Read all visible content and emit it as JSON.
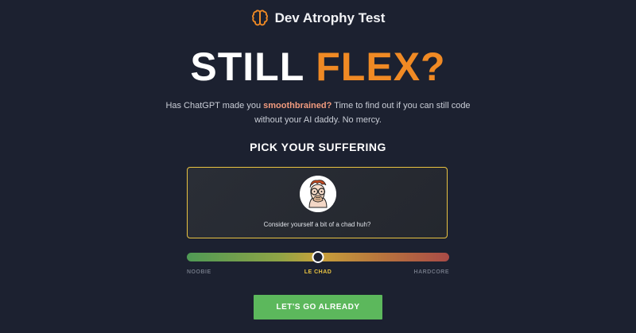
{
  "header": {
    "title": "Dev Atrophy Test",
    "icon": "brain-icon",
    "icon_color": "#f08a24"
  },
  "hero": {
    "word1": "STILL",
    "word2": "FLEX?",
    "accent_color": "#f08a24"
  },
  "subtitle": {
    "part1": "Has ChatGPT made you ",
    "highlight": "smoothbrained?",
    "part2": " Time to find out if you can still code without your AI daddy. No mercy."
  },
  "section": {
    "title": "PICK YOUR SUFFERING"
  },
  "difficulty": {
    "selected_index": 1,
    "level_fraction": 0.5,
    "card_text": "Consider yourself a bit of a chad huh?",
    "avatar": "chad-avatar",
    "labels": [
      "NOOBIE",
      "LE CHAD",
      "HARDCORE"
    ],
    "active_color": "#e9c341"
  },
  "cta": {
    "label": "LET'S GO ALREADY",
    "color": "#5cb85c"
  }
}
